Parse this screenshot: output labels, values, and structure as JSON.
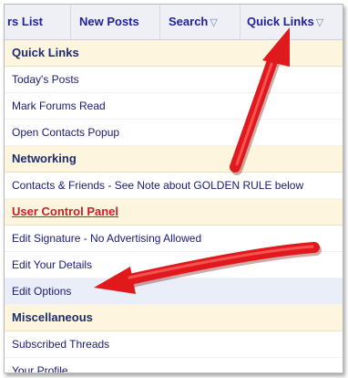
{
  "navbar": {
    "items": [
      {
        "label": "rs List"
      },
      {
        "label": "New Posts"
      },
      {
        "label": "Search",
        "caret": "▽"
      },
      {
        "label": "Quick Links",
        "caret": "▽"
      }
    ]
  },
  "menu": {
    "sections": [
      {
        "header": "Quick Links",
        "items": [
          "Today's Posts",
          "Mark Forums Read",
          "Open Contacts Popup"
        ]
      },
      {
        "header": "Networking",
        "items": [
          "Contacts & Friends - See Note about GOLDEN RULE below"
        ]
      },
      {
        "header": "User Control Panel",
        "items": [
          "Edit Signature - No Advertising Allowed",
          "Edit Your Details",
          "Edit Options"
        ]
      },
      {
        "header": "Miscellaneous",
        "items": [
          "Subscribed Threads",
          "Your Profile"
        ]
      }
    ]
  },
  "colors": {
    "header_bg": "#fdf5dd",
    "link": "#1a1a78",
    "header_text": "#1c2d72",
    "emphasis_red": "#c8202a",
    "arrow": "#e0191c"
  },
  "annotations": [
    {
      "name": "arrow-icon",
      "points_to": "Quick Links"
    },
    {
      "name": "arrow-icon",
      "points_to": "Edit Options"
    }
  ]
}
